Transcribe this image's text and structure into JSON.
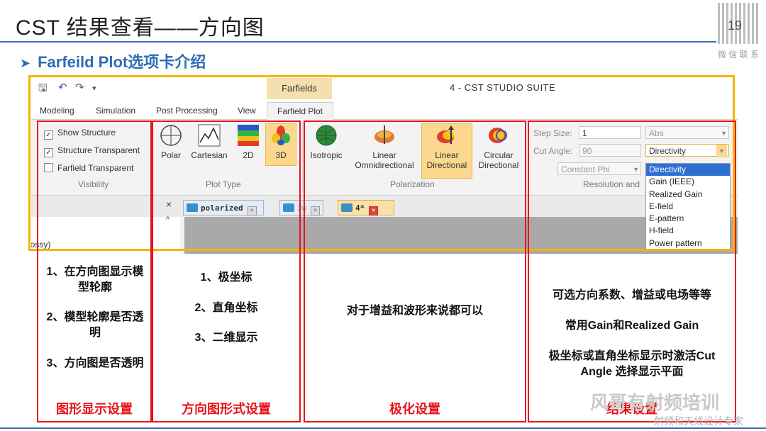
{
  "slide": {
    "title": "CST 结果查看——方向图",
    "page_number": "19",
    "qr_caption": "微 信 联 系",
    "subtitle": "Farfeild Plot选项卡介绍",
    "arrow": "➤"
  },
  "app": {
    "title": "4 - CST STUDIO SUITE",
    "context_tab": "Farfields",
    "tabs": [
      "Modeling",
      "Simulation",
      "Post Processing",
      "View"
    ],
    "active_tab": "Farfield Plot",
    "qat": {
      "save_icon": "save-icon",
      "undo_icon": "undo-icon",
      "redo_icon": "redo-icon",
      "more": "▾"
    }
  },
  "ribbon": {
    "visibility": {
      "label": "Visibility",
      "items": [
        {
          "label": "Show Structure",
          "checked": true
        },
        {
          "label": "Structure Transparent",
          "checked": true
        },
        {
          "label": "Farfield Transparent",
          "checked": false
        }
      ],
      "check_mark": "✓"
    },
    "plot_type": {
      "label": "Plot Type",
      "buttons": [
        {
          "label": "Polar",
          "icon": "polar-icon"
        },
        {
          "label": "Cartesian",
          "icon": "cartesian-icon"
        },
        {
          "label": "2D",
          "icon": "2d-plot-icon"
        },
        {
          "label": "3D",
          "icon": "3d-plot-icon",
          "selected": true
        }
      ]
    },
    "polarization": {
      "label": "Polarization",
      "buttons": [
        {
          "label": "Isotropic",
          "icon": "isotropic-icon"
        },
        {
          "label": "Linear",
          "label2": "Omnidirectional",
          "icon": "linear-omni-icon"
        },
        {
          "label": "Linear",
          "label2": "Directional",
          "icon": "linear-directional-icon",
          "selected": true
        },
        {
          "label": "Circular",
          "label2": "Directional",
          "icon": "circular-directional-icon"
        }
      ]
    },
    "resolution": {
      "label": "Resolution and",
      "step_size_label": "Step Size:",
      "step_size_value": "1",
      "cut_angle_label": "Cut Angle:",
      "cut_angle_value": "90",
      "phi_select": "Constant Phi",
      "abs_select": "Abs",
      "quantity_select": "Directivity",
      "dropdown_options": [
        "Directivity",
        "Gain (IEEE)",
        "Realized Gain",
        "E-field",
        "E-pattern",
        "H-field",
        "Power pattern"
      ]
    }
  },
  "doc_tabs": [
    {
      "label": "polarized",
      "active": false
    },
    {
      "label": "3w",
      "active": false
    },
    {
      "label": "4*",
      "active": true
    }
  ],
  "left_pane": {
    "text": "lossy)",
    "close": "×",
    "scroll_up": "^"
  },
  "notes": {
    "visibility": [
      "1、在方向图显示模型轮廓",
      "2、模型轮廓是否透明",
      "3、方向图是否透明"
    ],
    "plot_type": [
      "1、极坐标",
      "2、直角坐标",
      "3、二维显示"
    ],
    "polarization": [
      "对于增益和波形来说都可以"
    ],
    "result": [
      "可选方向系数、增益或电场等等",
      "常用Gain和Realized Gain",
      "极坐标或直角坐标显示时激活Cut Angle 选择显示平面"
    ]
  },
  "captions": {
    "visibility": "图形显示设置",
    "plot_type": "方向图形式设置",
    "polarization": "极化设置",
    "result": "结果设置"
  },
  "watermark": {
    "line1": "风哥有射频培训",
    "line2": "射频和天线设计专家"
  },
  "colors": {
    "accent_blue": "#2e6db4",
    "annotation_red": "#e8141b",
    "annotation_yellow": "#f5b400",
    "selected_button": "#fbd88e"
  }
}
